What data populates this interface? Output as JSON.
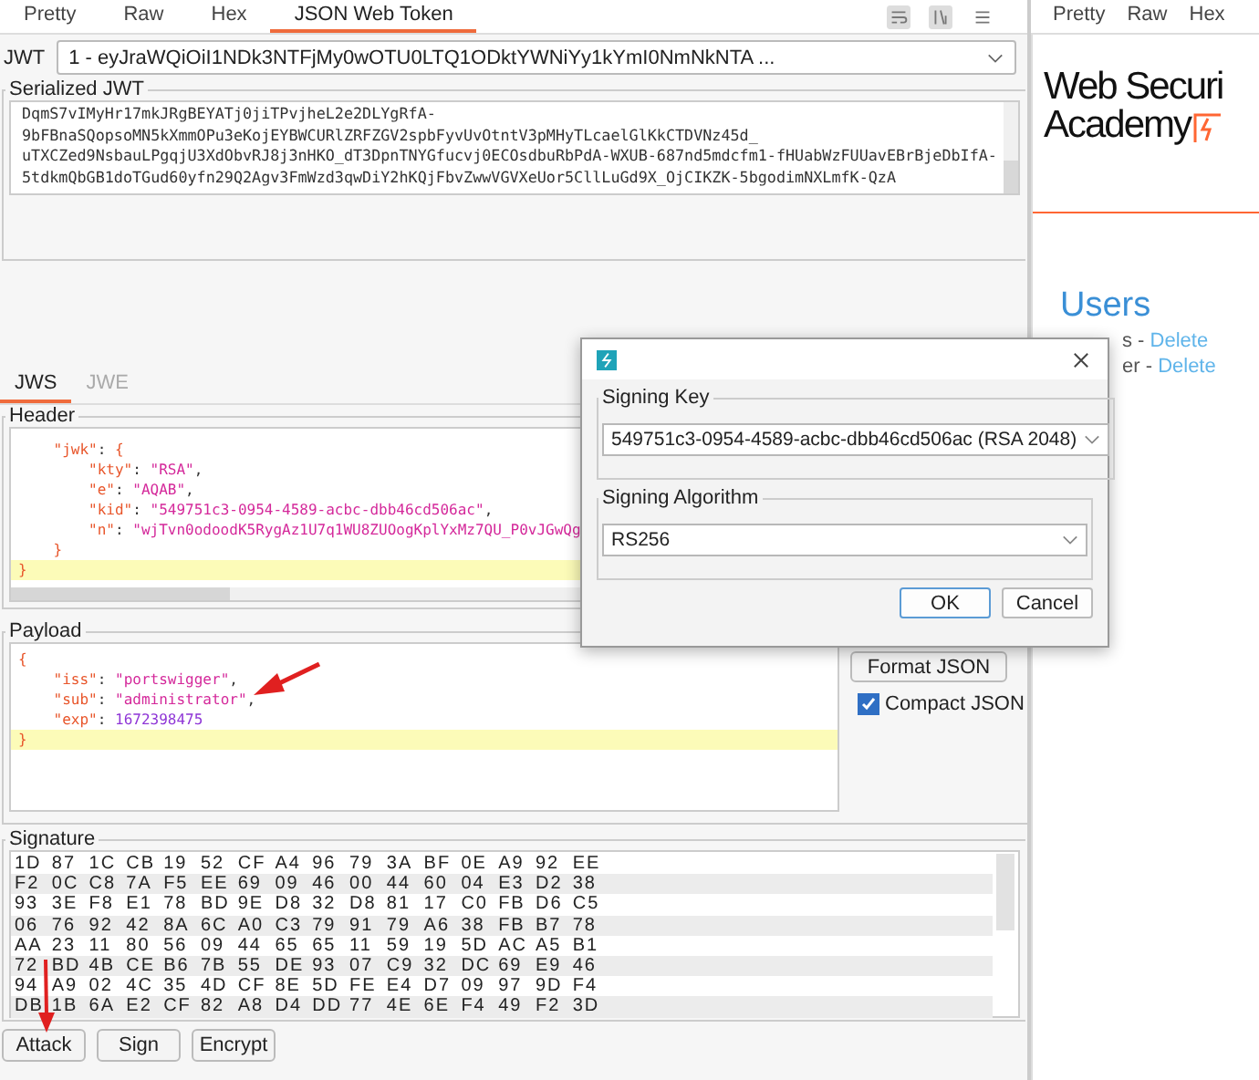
{
  "tabs": [
    {
      "label": "Pretty",
      "selected": false
    },
    {
      "label": "Raw",
      "selected": false
    },
    {
      "label": "Hex",
      "selected": false
    },
    {
      "label": "JSON Web Token",
      "selected": true
    }
  ],
  "jwt_selector": {
    "label": "JWT",
    "value": "1 - eyJraWQiOiI1NDk3NTFjMy0wOTU0LTQ1ODktYWNiYy1kYmI0NmNkNTA ..."
  },
  "serialized_jwt": {
    "title": "Serialized JWT",
    "lines": [
      "DqmS7vIMyHr17mkJRgBEYATj0jiTPvjheL2e2DLYgRfA-",
      "9bFBnaSQopsoMN5kXmmOPu3eKojEYBWCURlZRFZGV2spbFyvUvOtntV3pMHyTLcaelGlKkCTDVNz45d_",
      "uTXCZed9NsbauLPgqjU3XdObvRJ8j3nHKO_dT3DpnTNYGfucvj0ECOsdbuRbPdA-WXUB-687nd5mdcfm1-fHUabWzFUUavEBrBjeDbIfA-",
      "5tdkmQbGB1doTGud60yfn29Q2Agv3FmWzd3qwDiY2hKQjFbvZwwVGVXeUor5CllLuGd9X_OjCIKZK-5bgodimNXLmfK-QzA"
    ]
  },
  "mode_tabs": [
    {
      "label": "JWS",
      "selected": true
    },
    {
      "label": "JWE",
      "selected": false
    }
  ],
  "header": {
    "title": "Header",
    "lines": [
      {
        "text": "    \"jwk\": {",
        "highlighted": false
      },
      {
        "text": "        \"kty\": \"RSA\",",
        "highlighted": false
      },
      {
        "text": "        \"e\": \"AQAB\",",
        "highlighted": false
      },
      {
        "text": "        \"kid\": \"549751c3-0954-4589-acbc-dbb46cd506ac\",",
        "highlighted": false
      },
      {
        "text": "        \"n\": \"wjTvn0odoodK5RygAz1U7q1WU8ZUOogKplYxMz7QU_P0vJGwQg",
        "highlighted": false
      },
      {
        "text": "    }",
        "highlighted": false
      },
      {
        "text": "}",
        "highlighted": true
      }
    ]
  },
  "payload": {
    "title": "Payload",
    "lines": [
      {
        "text": "{",
        "highlighted": false
      },
      {
        "text": "    \"iss\": \"portswigger\",",
        "highlighted": false
      },
      {
        "text": "    \"sub\": \"administrator\",",
        "highlighted": false
      },
      {
        "text": "    \"exp\": 1672398475",
        "highlighted": false
      },
      {
        "text": "}",
        "highlighted": true
      }
    ],
    "format_button": "Format JSON",
    "compact_json": {
      "label": "Compact JSON",
      "checked": true
    }
  },
  "signature": {
    "title": "Signature",
    "rows": [
      [
        "1D",
        "87",
        "1C",
        "CB",
        "19",
        "52",
        "CF",
        "A4",
        "96",
        "79",
        "3A",
        "BF",
        "0E",
        "A9",
        "92",
        "EE"
      ],
      [
        "F2",
        "0C",
        "C8",
        "7A",
        "F5",
        "EE",
        "69",
        "09",
        "46",
        "00",
        "44",
        "60",
        "04",
        "E3",
        "D2",
        "38"
      ],
      [
        "93",
        "3E",
        "F8",
        "E1",
        "78",
        "BD",
        "9E",
        "D8",
        "32",
        "D8",
        "81",
        "17",
        "C0",
        "FB",
        "D6",
        "C5"
      ],
      [
        "06",
        "76",
        "92",
        "42",
        "8A",
        "6C",
        "A0",
        "C3",
        "79",
        "91",
        "79",
        "A6",
        "38",
        "FB",
        "B7",
        "78"
      ],
      [
        "AA",
        "23",
        "11",
        "80",
        "56",
        "09",
        "44",
        "65",
        "65",
        "11",
        "59",
        "19",
        "5D",
        "AC",
        "A5",
        "B1"
      ],
      [
        "72",
        "BD",
        "4B",
        "CE",
        "B6",
        "7B",
        "55",
        "DE",
        "93",
        "07",
        "C9",
        "32",
        "DC",
        "69",
        "E9",
        "46"
      ],
      [
        "94",
        "A9",
        "02",
        "4C",
        "35",
        "4D",
        "CF",
        "8E",
        "5D",
        "FE",
        "E4",
        "D7",
        "09",
        "97",
        "9D",
        "F4"
      ],
      [
        "DB",
        "1B",
        "6A",
        "E2",
        "CF",
        "82",
        "A8",
        "D4",
        "DD",
        "77",
        "4E",
        "6E",
        "F4",
        "49",
        "F2",
        "3D"
      ]
    ]
  },
  "actions": [
    "Attack",
    "Sign",
    "Encrypt"
  ],
  "right_pane": {
    "tabs": [
      "Pretty",
      "Raw",
      "Hex"
    ],
    "logo": [
      "Web Securi",
      "Academy"
    ],
    "heading": "Users",
    "users": [
      {
        "name": "s -",
        "action": "Delete"
      },
      {
        "name": "er -",
        "action": "Delete"
      }
    ]
  },
  "dialog": {
    "key_group": "Signing Key",
    "key_value": "549751c3-0954-4589-acbc-dbb46cd506ac (RSA 2048)",
    "algorithm_group": "Signing Algorithm",
    "algorithm_value": "RS256",
    "buttons": [
      {
        "label": "OK",
        "default": true
      },
      {
        "label": "Cancel",
        "default": false
      }
    ]
  }
}
